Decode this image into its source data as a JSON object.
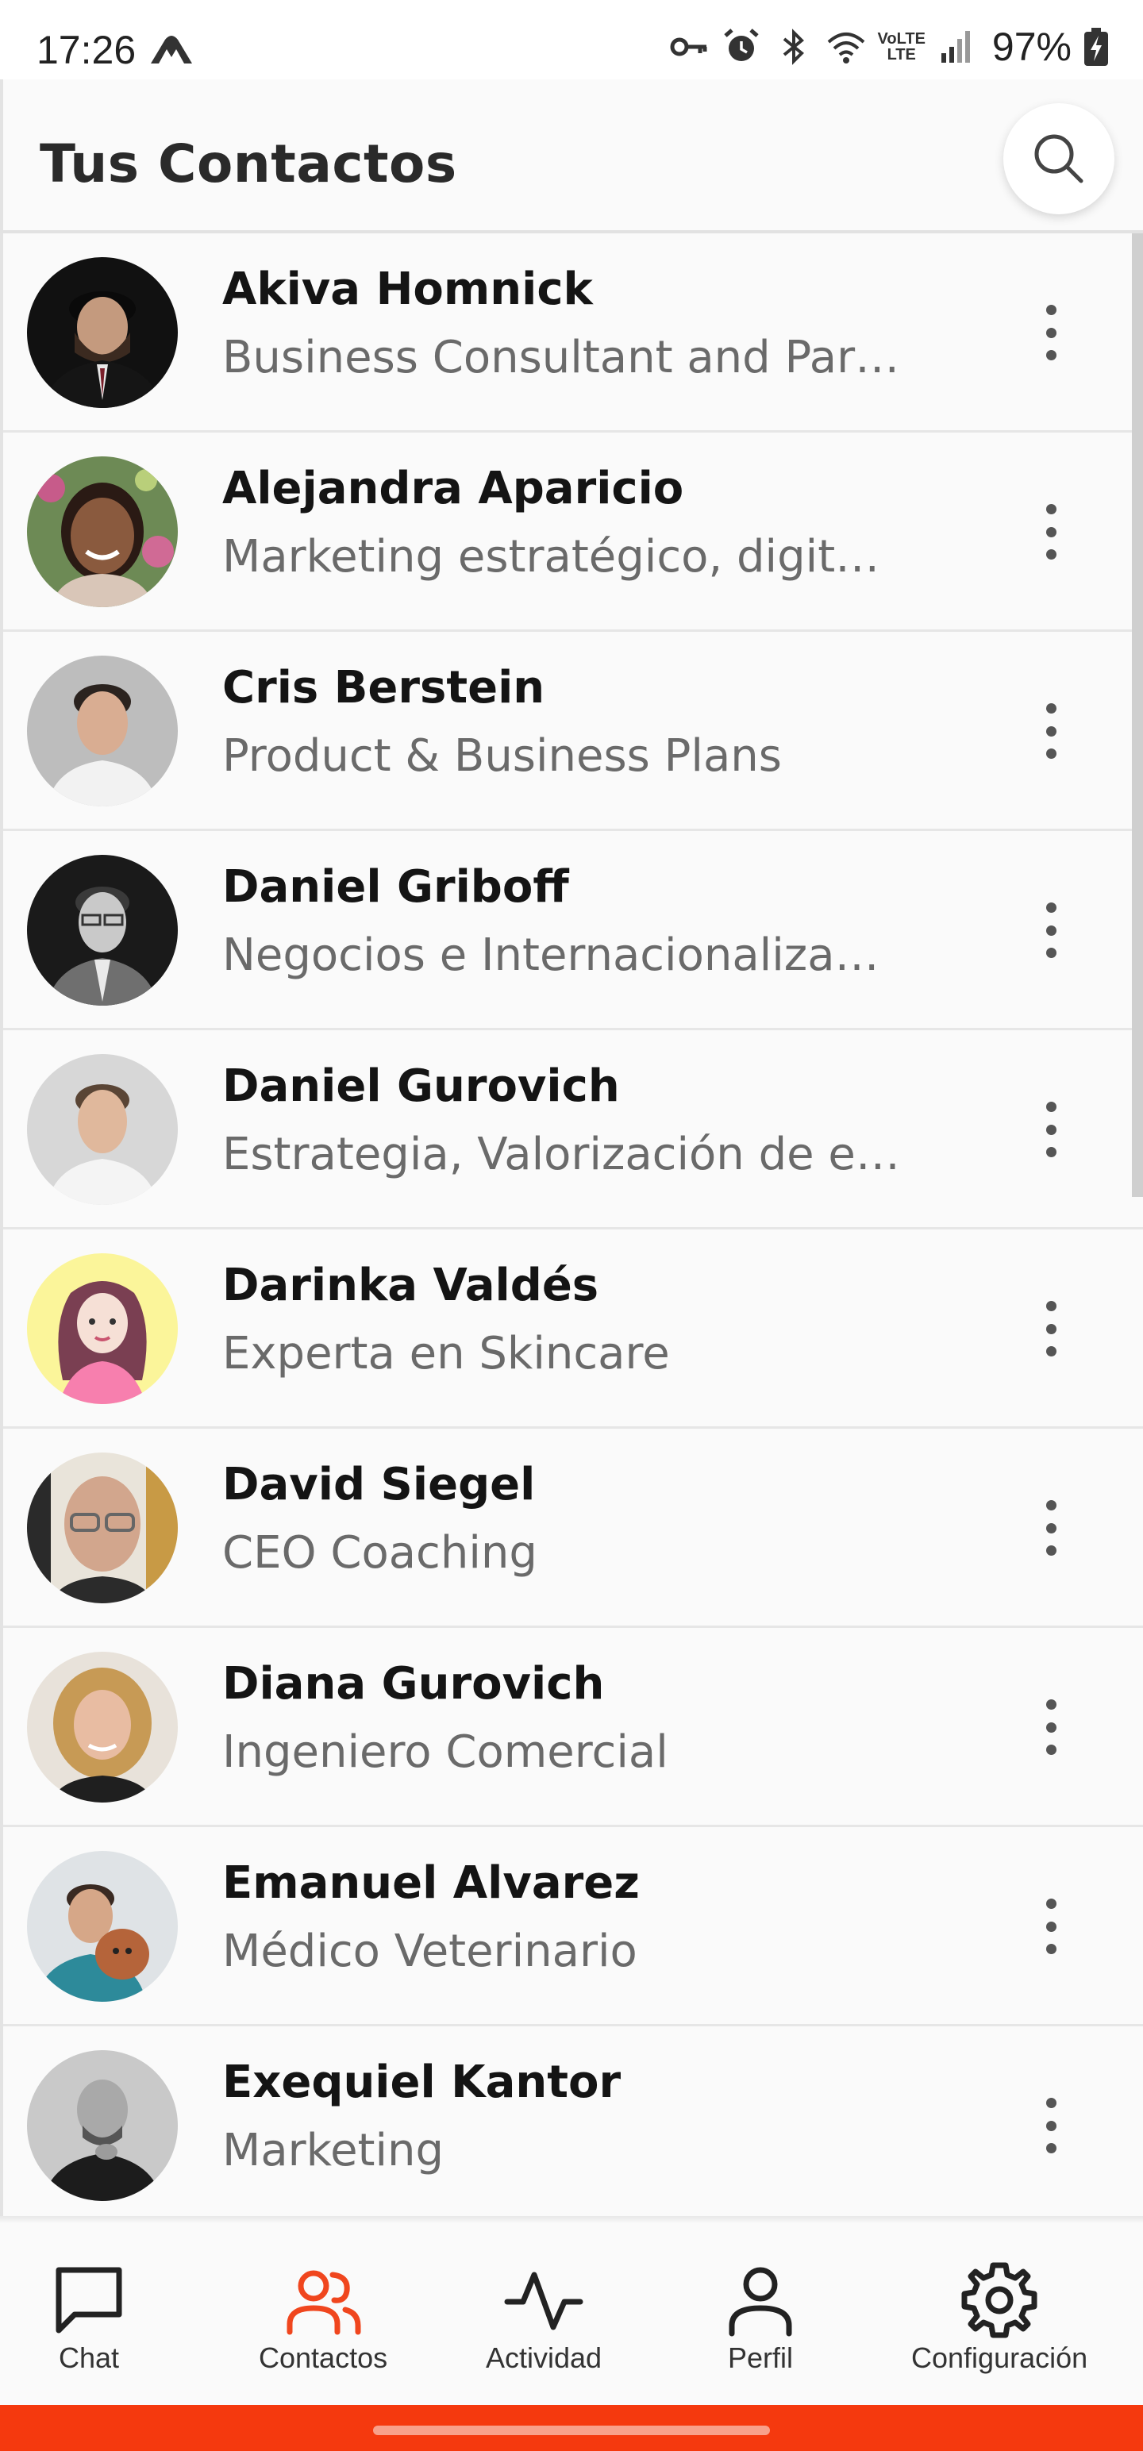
{
  "status_bar": {
    "time": "17:26",
    "battery": "97%",
    "network": "VoLTE",
    "lte": "LTE"
  },
  "header": {
    "title": "Tus Contactos"
  },
  "contacts": [
    {
      "name": "Akiva Homnick",
      "description": "Business Consultant and Par…"
    },
    {
      "name": "Alejandra Aparicio",
      "description": "Marketing estratégico, digita…"
    },
    {
      "name": "Cris Berstein",
      "description": "Product & Business Plans"
    },
    {
      "name": "Daniel Griboff",
      "description": "Negocios e Internacionaliza…"
    },
    {
      "name": "Daniel Gurovich",
      "description": "Estrategia, Valorización de e…"
    },
    {
      "name": "Darinka Valdés",
      "description": "Experta en Skincare"
    },
    {
      "name": "David Siegel",
      "description": "CEO Coaching"
    },
    {
      "name": "Diana Gurovich",
      "description": "Ingeniero Comercial"
    },
    {
      "name": "Emanuel Alvarez",
      "description": "Médico Veterinario"
    },
    {
      "name": "Exequiel Kantor",
      "description": "Marketing"
    }
  ],
  "bottom_nav": {
    "chat": "Chat",
    "contacts": "Contactos",
    "activity": "Actividad",
    "profile": "Perfil",
    "settings": "Configuración",
    "active": "contacts",
    "active_color": "#f0461e"
  },
  "colors": {
    "accent": "#f5390e"
  }
}
